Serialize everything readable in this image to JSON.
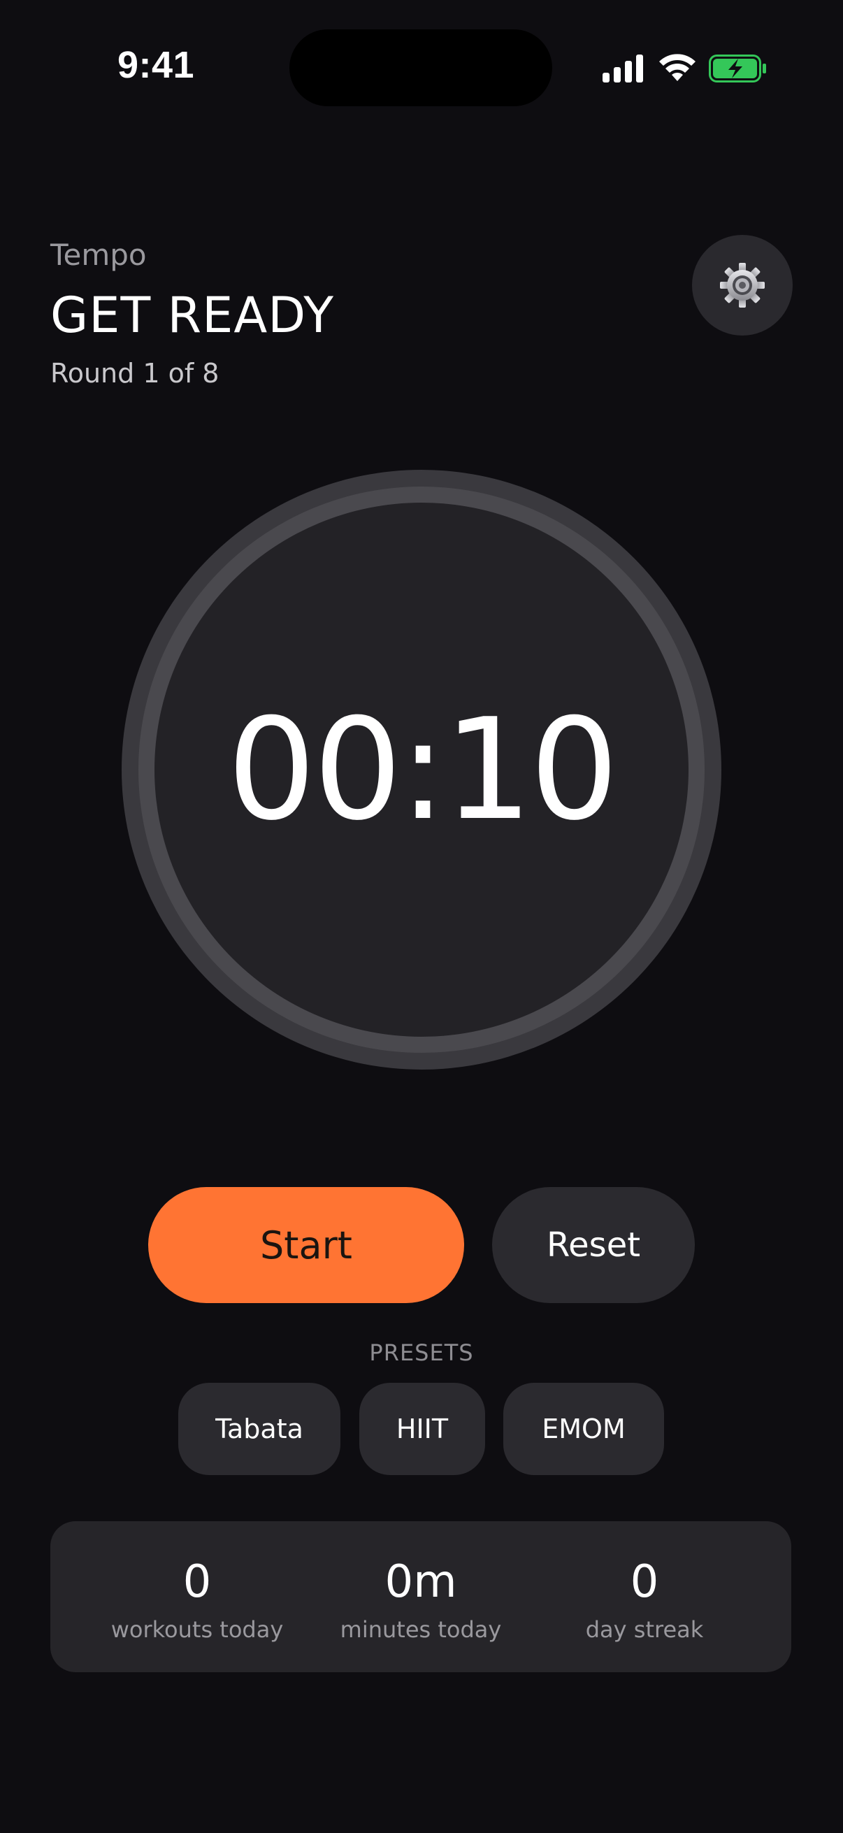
{
  "status_bar": {
    "time": "9:41",
    "icons": [
      "signal-icon",
      "wifi-icon",
      "battery-charging-icon"
    ],
    "battery_color": "#34c759"
  },
  "header": {
    "app_name": "Tempo",
    "phase": "GET READY",
    "round": "Round 1 of 8",
    "settings_icon": "gear-icon"
  },
  "timer": {
    "display": "00:10",
    "progress": 0
  },
  "controls": {
    "start_label": "Start",
    "reset_label": "Reset",
    "accent_color": "#ff7433"
  },
  "presets": {
    "label": "PRESETS",
    "items": [
      "Tabata",
      "HIIT",
      "EMOM"
    ]
  },
  "stats": [
    {
      "value": "0",
      "label": "workouts today"
    },
    {
      "value": "0m",
      "label": "minutes today"
    },
    {
      "value": "0",
      "label": "day streak"
    }
  ]
}
